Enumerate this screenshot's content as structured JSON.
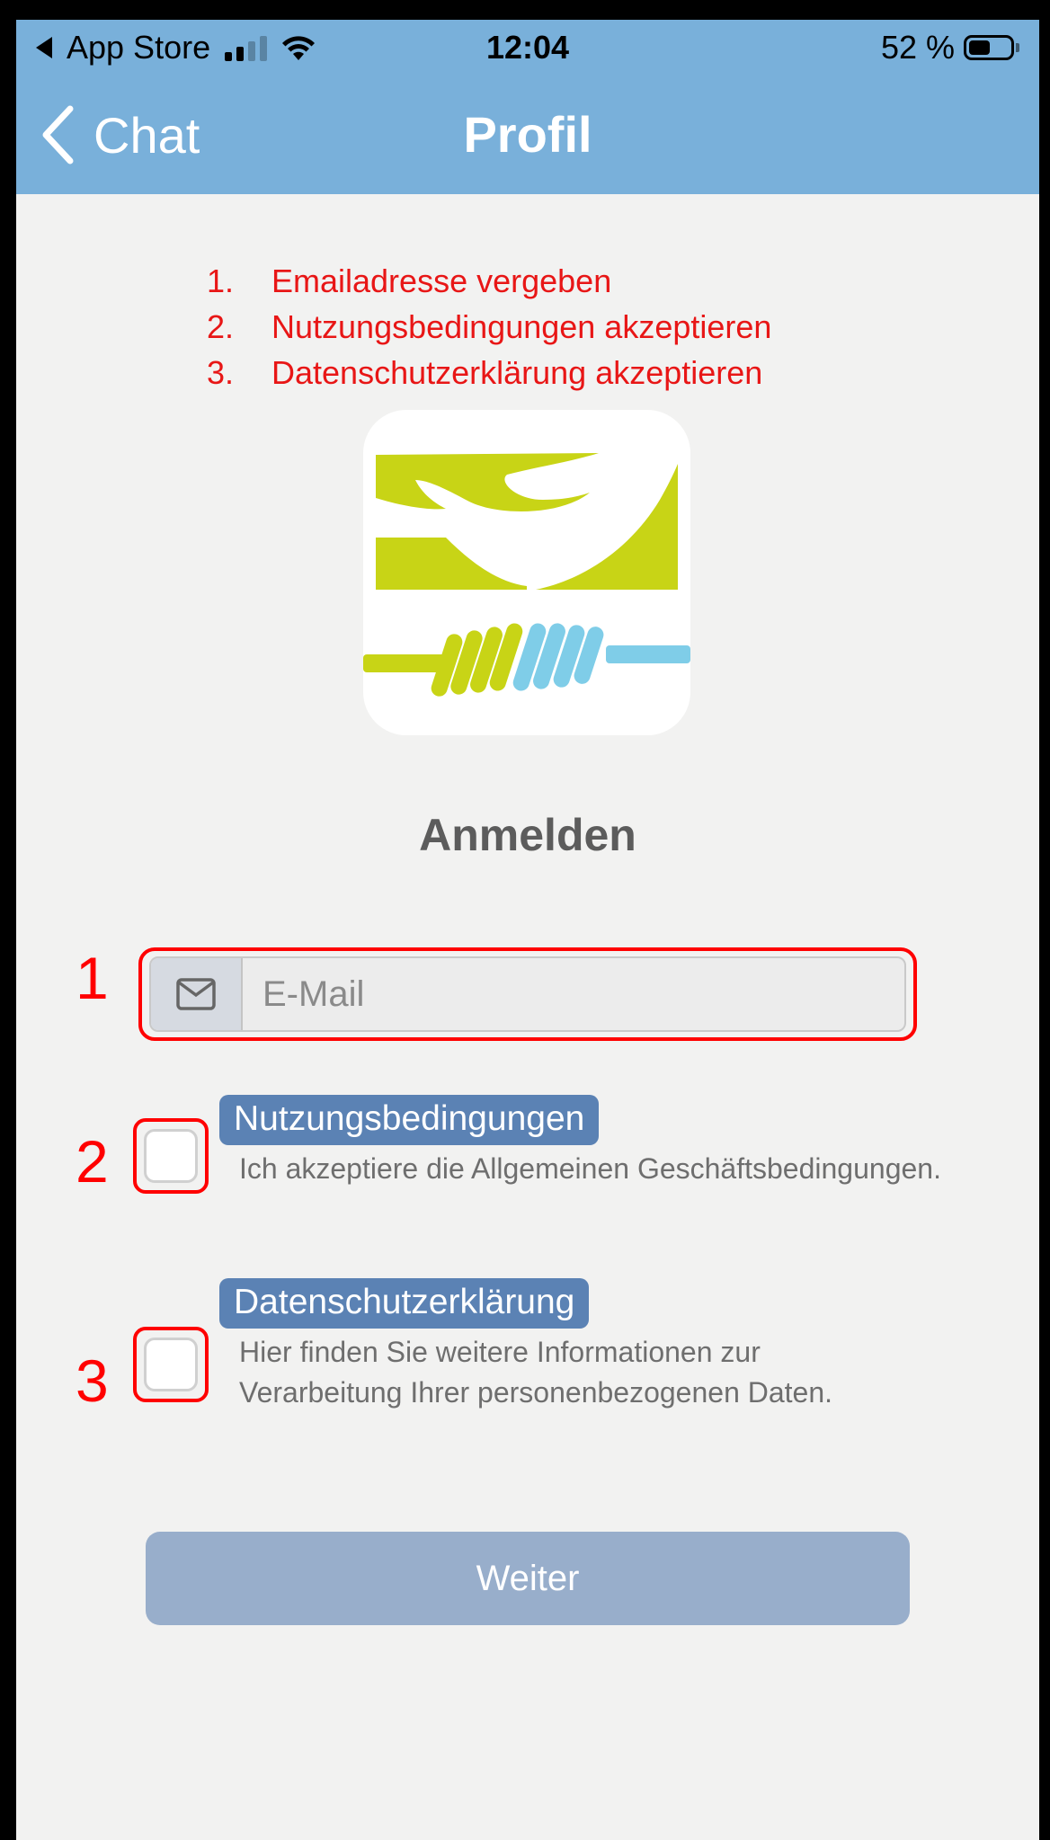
{
  "status_bar": {
    "carrier": "App Store",
    "time": "12:04",
    "battery": "52 %",
    "battery_level": 0.52
  },
  "nav": {
    "back_label": "Chat",
    "title": "Profil"
  },
  "instructions": [
    {
      "number": "1.",
      "text": "Emailadresse vergeben"
    },
    {
      "number": "2.",
      "text": "Nutzungsbedingungen akzeptieren"
    },
    {
      "number": "3.",
      "text": "Datenschutzerklärung akzeptieren"
    }
  ],
  "heading": "Anmelden",
  "email": {
    "placeholder": "E-Mail",
    "value": "",
    "icon": "envelope-icon"
  },
  "callout_numbers": [
    "1",
    "2",
    "3"
  ],
  "terms": {
    "title": "Nutzungsbedingungen",
    "description": "Ich akzeptiere die Allgemeinen Geschäftsbedingungen.",
    "checked": false
  },
  "privacy": {
    "title": "Datenschutzerklärung",
    "description": "Hier finden Sie weitere Informationen zur Verarbeitung Ihrer personenbezogenen Daten.",
    "checked": false
  },
  "continue_button": {
    "label": "Weiter",
    "enabled": false
  },
  "colors": {
    "header": "#79b0da",
    "annotation": "#ff0000",
    "badge": "#5b82b4",
    "button_disabled": "#98aecb",
    "logo_green": "#c8d416",
    "logo_blue": "#7fcde8"
  }
}
